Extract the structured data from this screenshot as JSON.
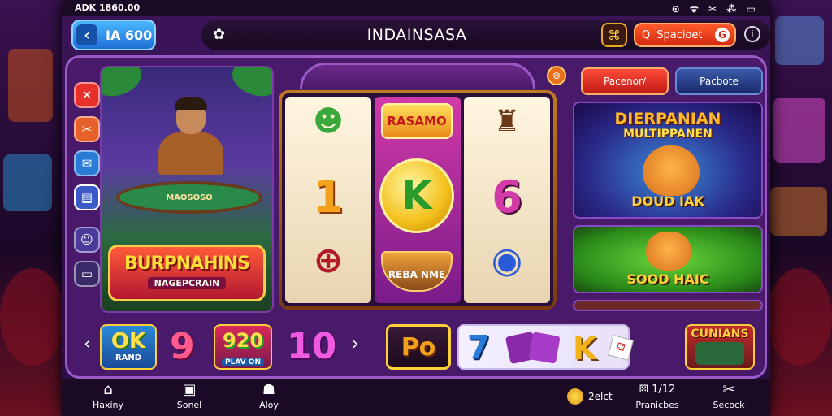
{
  "status_bar": {
    "left": "ADK 1860.00",
    "right": "⊙ ᯤ ✂ ⁂ ▭"
  },
  "header": {
    "back_label": "IA 600",
    "title": "INDAINSASA",
    "search_label_1": "Q",
    "search_label_2": "Spacioet",
    "search_label_3": "G"
  },
  "left_panel": {
    "table_label": "MAOSOSO",
    "banner_title": "BURPNAHINS",
    "banner_sub": "NAGEPCRAIN"
  },
  "slot": {
    "top_badge": "RASAMO",
    "reel1": {
      "top": "☻",
      "mid": "1",
      "bot": "⊕"
    },
    "reel2": {
      "mid": "K",
      "bot": "REBA NME"
    },
    "reel3": {
      "top": "♜",
      "mid": "6",
      "bot": "◉"
    }
  },
  "right_panel": {
    "btn_red": "Pacenor/",
    "btn_blue": "Pacbote",
    "promo1_title": "DIERPANIAN",
    "promo1_sub": "MULTIPPANEN",
    "promo1_bottom": "DOUD IAK",
    "promo2_bottom": "SOOD HAIC"
  },
  "strip": {
    "tile1_big": "OK",
    "tile1_small": "RAND",
    "num9": "9",
    "tile2_big": "920",
    "tile2_small": "PLAV ON",
    "num10": "10",
    "tile_po": "Po",
    "num7": "7",
    "tile_k": "K",
    "tile_last": "CUNIANS"
  },
  "nav": {
    "home": "Haxiny",
    "sonel": "Sonel",
    "alay": "Aloy",
    "coins": "2elct",
    "promo_num": "1/12",
    "promo_label": "Pranicbes",
    "search": "Secock"
  }
}
